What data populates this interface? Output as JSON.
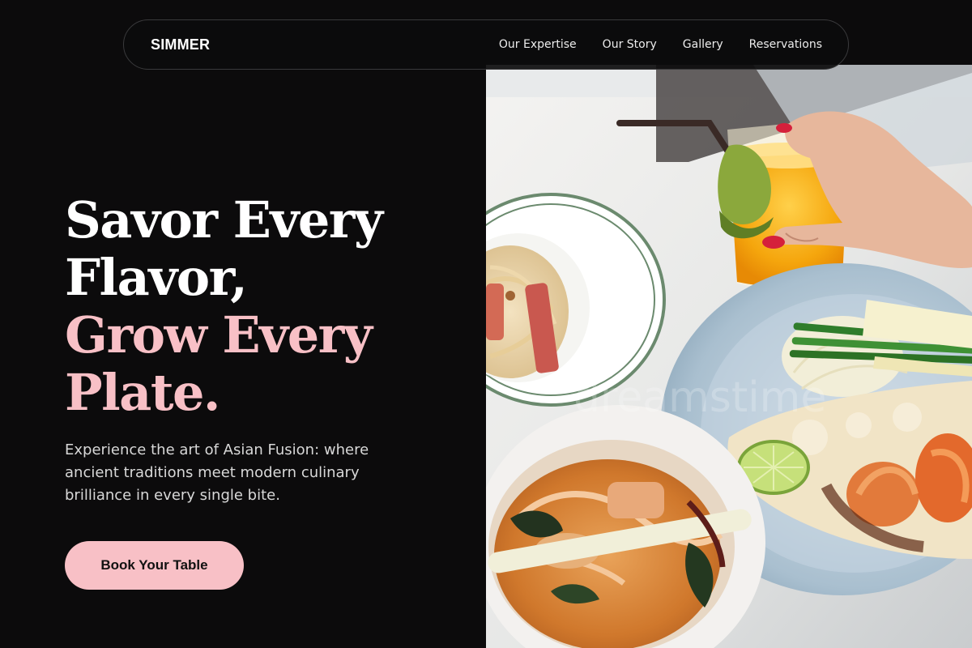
{
  "nav": {
    "brand": "SIMMER",
    "links": [
      "Our Expertise",
      "Our Story",
      "Gallery",
      "Reservations"
    ]
  },
  "hero": {
    "headline_line1": "Savor Every",
    "headline_line2": "Flavor,",
    "headline_line3": "Grow Every",
    "headline_line4": "Plate.",
    "subtitle": "Experience the art of Asian Fusion: where ancient traditions meet modern culinary brilliance in every single bite.",
    "cta_label": "Book Your Table"
  },
  "image": {
    "watermark": "dreamstime"
  },
  "colors": {
    "background": "#0c0b0c",
    "accent_pink": "#f8c0c6",
    "text": "#ffffff"
  }
}
